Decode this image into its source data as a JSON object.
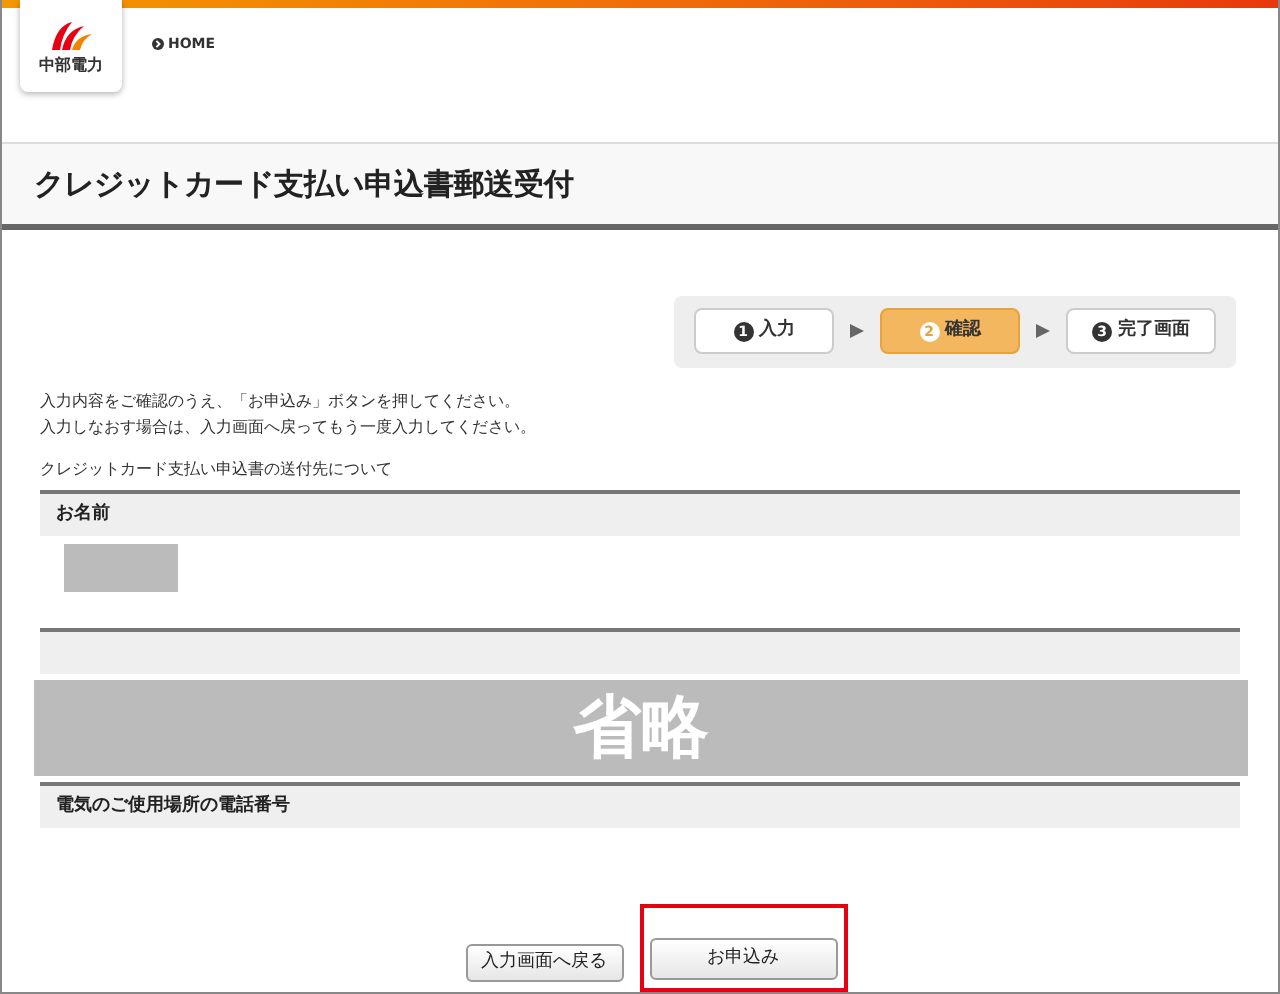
{
  "header": {
    "logo_text": "中部電力",
    "home_link": "HOME"
  },
  "page_title": "クレジットカード支払い申込書郵送受付",
  "steps": [
    {
      "number": "1",
      "label": "入力",
      "selected": false
    },
    {
      "number": "2",
      "label": "確認",
      "selected": true
    },
    {
      "number": "3",
      "label": "完了画面",
      "selected": false
    }
  ],
  "instructions": [
    "入力内容をご確認のうえ、「お申込み」ボタンを押してください。",
    "入力しなおす場合は、入力画面へ戻ってもう一度入力してください。"
  ],
  "section_caption": "クレジットカード支払い申込書の送付先について",
  "fields": [
    {
      "label": "お名前",
      "redacted": true
    }
  ],
  "omitted_overlay": "省略",
  "fields_after": [
    {
      "label": "電気のご使用場所の電話番号"
    }
  ],
  "buttons": [
    {
      "label": "入力画面へ戻る",
      "highlighted": false
    },
    {
      "label": "お申込み",
      "highlighted": true
    }
  ]
}
